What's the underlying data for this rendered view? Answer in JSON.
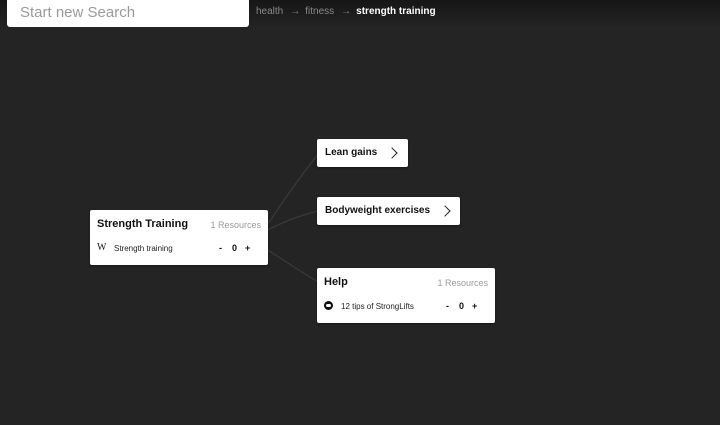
{
  "search": {
    "placeholder": "Start new Search",
    "value": ""
  },
  "breadcrumb": {
    "items": [
      "health",
      "fitness"
    ],
    "separator": "→",
    "current": "strength training"
  },
  "colors": {
    "background": "#242424",
    "card": "#ffffff",
    "link_line": "#3a3a3a"
  },
  "main_node": {
    "title": "Strength Training",
    "count": "1 Resources",
    "resource": {
      "icon": "wikipedia-icon",
      "label": "Strength training",
      "minus": "-",
      "votes": "0",
      "plus": "+"
    }
  },
  "children": [
    {
      "title": "Lean gains",
      "icon": "chevron-right-icon"
    },
    {
      "title": "Bodyweight exercises",
      "icon": "chevron-right-icon"
    }
  ],
  "help_node": {
    "title": "Help",
    "count": "1 Resources",
    "resource": {
      "icon": "reddit-icon",
      "label": "12 tips of StrongLifts",
      "minus": "-",
      "votes": "0",
      "plus": "+"
    }
  }
}
